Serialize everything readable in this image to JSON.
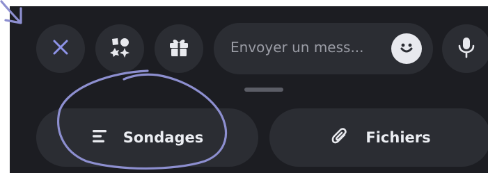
{
  "composer": {
    "close_icon": "close-icon",
    "apps_icon": "apps-icon",
    "gift_icon": "gift-icon",
    "message_placeholder": "Envoyer un mess...",
    "emoji_icon": "emoji-icon",
    "mic_icon": "microphone-icon"
  },
  "actions": {
    "polls_label": "Sondages",
    "polls_icon": "polls-icon",
    "files_label": "Fichiers",
    "files_icon": "paperclip-icon"
  },
  "colors": {
    "background": "#1c1d22",
    "button": "#2b2d33",
    "accent": "#8e93e8",
    "annotation": "#8d8fd0",
    "text": "#eceef3",
    "placeholder": "#9a9ca5"
  }
}
